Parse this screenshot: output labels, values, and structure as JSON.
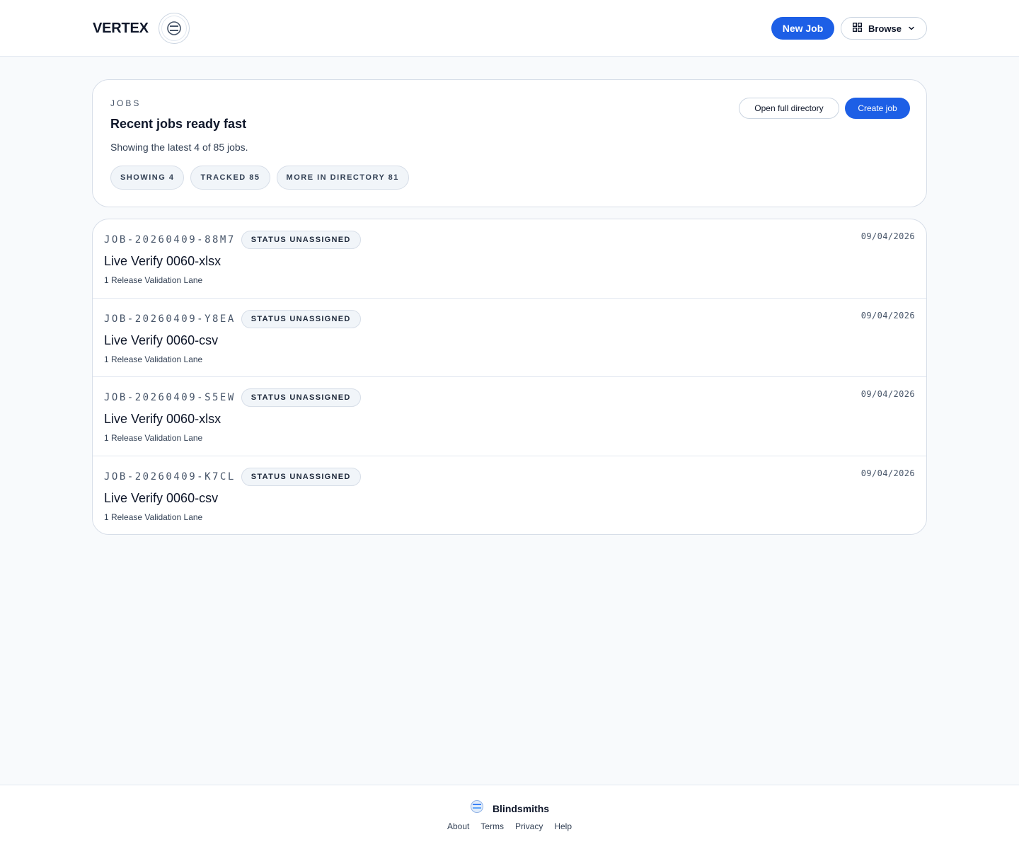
{
  "header": {
    "brand_name": "VERTEX",
    "logo_icon": "brand-logo-icon",
    "new_job_label": "New Job",
    "browse_label": "Browse",
    "browse_icon": "grid-icon",
    "browse_chevron_icon": "chevron-down-icon"
  },
  "summary": {
    "eyebrow": "JOBS",
    "title": "Recent jobs ready fast",
    "subtitle": "Showing the latest 4 of 85 jobs.",
    "pills": [
      "SHOWING 4",
      "TRACKED 85",
      "MORE IN DIRECTORY 81"
    ],
    "open_directory_label": "Open full directory",
    "create_job_label": "Create job"
  },
  "jobs": [
    {
      "id": "JOB-20260409-88M7",
      "status": "STATUS UNASSIGNED",
      "title": "Live Verify 0060-xlsx",
      "lane": "1 Release Validation Lane",
      "date": "09/04/2026"
    },
    {
      "id": "JOB-20260409-Y8EA",
      "status": "STATUS UNASSIGNED",
      "title": "Live Verify 0060-csv",
      "lane": "1 Release Validation Lane",
      "date": "09/04/2026"
    },
    {
      "id": "JOB-20260409-S5EW",
      "status": "STATUS UNASSIGNED",
      "title": "Live Verify 0060-xlsx",
      "lane": "1 Release Validation Lane",
      "date": "09/04/2026"
    },
    {
      "id": "JOB-20260409-K7CL",
      "status": "STATUS UNASSIGNED",
      "title": "Live Verify 0060-csv",
      "lane": "1 Release Validation Lane",
      "date": "09/04/2026"
    }
  ],
  "footer": {
    "brand_name": "Blindsmiths",
    "brand_icon": "blindsmiths-logo-icon",
    "links": [
      "About",
      "Terms",
      "Privacy",
      "Help"
    ]
  },
  "colors": {
    "accent": "#1d5fe6",
    "page_background": "#f8fafc",
    "border": "#d7dee8",
    "text": "#0f172a"
  }
}
